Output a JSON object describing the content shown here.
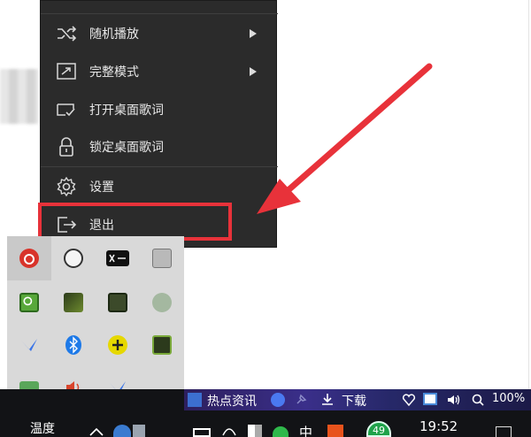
{
  "context_menu": {
    "items": [
      {
        "label": "随机播放",
        "icon": "shuffle-icon",
        "has_submenu": true
      },
      {
        "label": "完整模式",
        "icon": "expand-icon",
        "has_submenu": true
      },
      {
        "label": "打开桌面歌词",
        "icon": "lyrics-open-icon",
        "has_submenu": false
      },
      {
        "label": "锁定桌面歌词",
        "icon": "lock-icon",
        "has_submenu": false
      },
      {
        "label": "设置",
        "icon": "gear-icon",
        "has_submenu": false
      },
      {
        "label": "退出",
        "icon": "exit-icon",
        "has_submenu": false
      }
    ]
  },
  "annotation": {
    "highlight_color": "#e8323a",
    "target_item": "退出"
  },
  "tray_icons": [
    "netease-music-icon",
    "soccer-icon",
    "xmeta-icon",
    "printer-icon",
    "green-g-icon",
    "gpu-icon",
    "chip-icon",
    "user-icon",
    "feishu-icon",
    "bluetooth-icon",
    "plus-badge-icon",
    "nvidia-icon",
    "shield-check-icon",
    "speaker-icon",
    "feishu-icon-2"
  ],
  "taskbar": {
    "weather_label": "温度",
    "news_label": "热点资讯",
    "download_label": "下载",
    "zoom_label": "100%",
    "time": "19:52",
    "ime_label": "中",
    "badge_count": "49"
  }
}
